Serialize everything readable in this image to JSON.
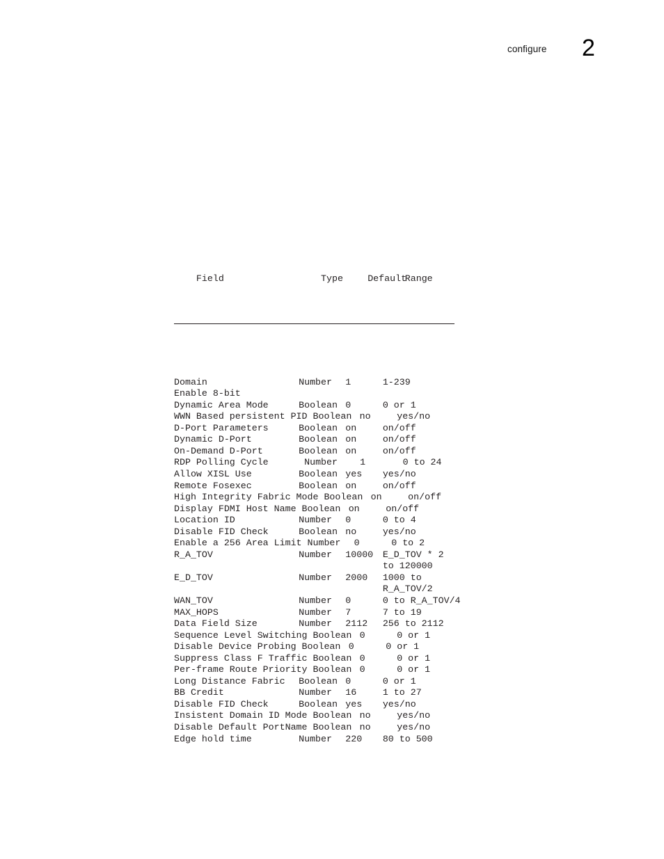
{
  "header": {
    "running_title": "configure",
    "chapter_number": "2"
  },
  "table": {
    "columns": {
      "field": "Field",
      "type": "Type",
      "default": "Default",
      "range": "Range"
    },
    "rows": [
      {
        "field": "Domain",
        "type": "Number",
        "default": "1",
        "range": "1-239"
      },
      {
        "field": "Enable 8-bit",
        "type": "",
        "default": "",
        "range": ""
      },
      {
        "field": "Dynamic Area Mode",
        "type": "Boolean",
        "default": "0",
        "range": "0 or 1"
      },
      {
        "field": "WWN Based persistent PID",
        "type": "Boolean",
        "default": "no",
        "range": "yes/no"
      },
      {
        "field": "D-Port Parameters",
        "type": "Boolean",
        "default": "on",
        "range": "on/off"
      },
      {
        "field": "Dynamic D-Port",
        "type": "Boolean",
        "default": "on",
        "range": "on/off"
      },
      {
        "field": "On-Demand D-Port",
        "type": "Boolean",
        "default": "on",
        "range": "on/off"
      },
      {
        "field": "RDP Polling Cycle",
        "type": "Number",
        "default": "1",
        "range": "0 to 24",
        "indent": 1
      },
      {
        "field": "Allow XISL Use",
        "type": "Boolean",
        "default": "yes",
        "range": "yes/no"
      },
      {
        "field": "Remote Fosexec",
        "type": "Boolean",
        "default": "on",
        "range": "on/off"
      },
      {
        "field": "High Integrity Fabric Mode",
        "type": "Boolean",
        "default": "on",
        "range": "on/off"
      },
      {
        "field": "Display FDMI Host Name",
        "type": "Boolean",
        "default": "on",
        "range": "on/off"
      },
      {
        "field": "Location ID",
        "type": "Number",
        "default": "0",
        "range": "0 to 4"
      },
      {
        "field": "Disable FID Check",
        "type": "Boolean",
        "default": "no",
        "range": "yes/no"
      },
      {
        "field": "Enable a 256 Area Limit",
        "type": "Number",
        "default": "0",
        "range": "0 to 2"
      },
      {
        "field": "R_A_TOV",
        "type": "Number",
        "default": "10000",
        "range": "E_D_TOV * 2"
      },
      {
        "field": "",
        "type": "",
        "default": "",
        "range": "to 120000"
      },
      {
        "field": "E_D_TOV",
        "type": "Number",
        "default": "2000",
        "range": "1000 to"
      },
      {
        "field": "",
        "type": "",
        "default": "",
        "range": "R_A_TOV/2"
      },
      {
        "field": "WAN_TOV",
        "type": "Number",
        "default": "0",
        "range": "0 to R_A_TOV/4"
      },
      {
        "field": "MAX_HOPS",
        "type": "Number",
        "default": "7",
        "range": "7 to 19"
      },
      {
        "field": "Data Field Size",
        "type": "Number",
        "default": "2112",
        "range": "256 to 2112"
      },
      {
        "field": "Sequence Level Switching",
        "type": "Boolean",
        "default": "0",
        "range": "0 or 1"
      },
      {
        "field": "Disable Device Probing",
        "type": "Boolean",
        "default": "0",
        "range": "0 or 1"
      },
      {
        "field": "Suppress Class F Traffic",
        "type": "Boolean",
        "default": "0",
        "range": "0 or 1"
      },
      {
        "field": "Per-frame Route Priority",
        "type": "Boolean",
        "default": "0",
        "range": "0 or 1"
      },
      {
        "field": "Long Distance Fabric",
        "type": "Boolean",
        "default": "0",
        "range": "0 or 1"
      },
      {
        "field": "BB Credit",
        "type": "Number",
        "default": "16",
        "range": "1 to 27"
      },
      {
        "field": "Disable FID Check",
        "type": "Boolean",
        "default": "yes",
        "range": "yes/no"
      },
      {
        "field": "Insistent Domain ID Mode",
        "type": "Boolean",
        "default": "no",
        "range": "yes/no"
      },
      {
        "field": "Disable Default PortName",
        "type": "Boolean",
        "default": "no",
        "range": "yes/no"
      },
      {
        "field": "Edge hold time",
        "type": "Number",
        "default": "220",
        "range": "80 to 500"
      }
    ]
  }
}
